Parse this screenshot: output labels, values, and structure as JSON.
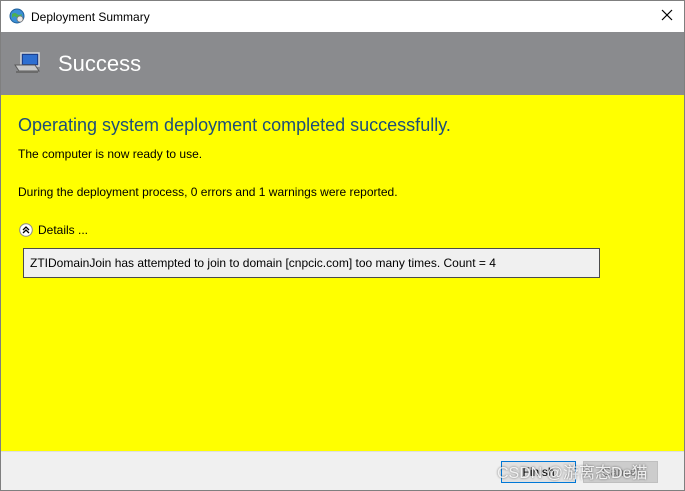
{
  "window": {
    "title": "Deployment Summary",
    "close_icon": "close-icon",
    "app_icon": "globe-icon"
  },
  "header": {
    "title": "Success",
    "icon": "computer-monitor-icon",
    "background": "#8a8b8e"
  },
  "content": {
    "background": "#ffff00",
    "heading": "Operating system deployment completed successfully.",
    "ready_message": "The computer is now ready to use.",
    "summary_message": "During the deployment process, 0 errors and 1 warnings were reported.",
    "details_label": "Details ...",
    "details_icon": "collapse-chevron-icon",
    "details_lines": [
      "ZTIDomainJoin has attempted to join to domain [cnpcic.com] too many times. Count = 4"
    ]
  },
  "footer": {
    "finish_label": "Finish",
    "cancel_label": "Cancel"
  },
  "watermark": {
    "text": "CSDN @游离态De猫"
  }
}
